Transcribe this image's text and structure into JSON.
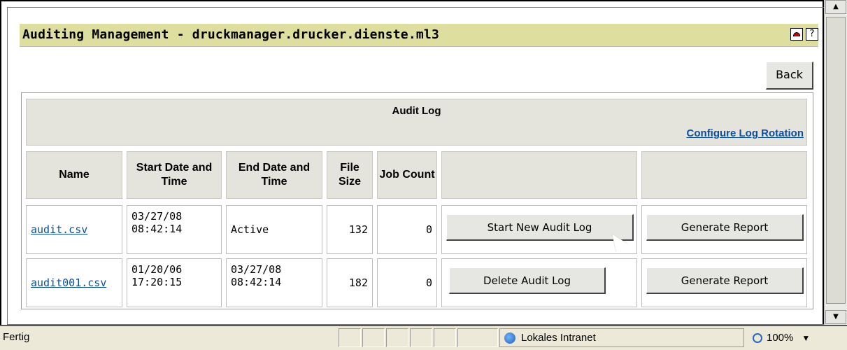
{
  "window": {
    "title": "Auditing Management - druckmanager.drucker.dienste.ml3",
    "back_label": "Back",
    "help_icon_text": "?"
  },
  "audit": {
    "title": "Audit Log",
    "rotation_link": "Configure Log Rotation",
    "columns": [
      "Name",
      "Start Date and Time",
      "End Date and Time",
      "File Size",
      "Job Count"
    ],
    "rows": [
      {
        "name": "audit.csv",
        "start_date": "03/27/08",
        "start_time": "08:42:14",
        "end_text": "Active",
        "size": "132",
        "job_count": "0",
        "action_label": "Start New Audit Log",
        "report_label": "Generate Report"
      },
      {
        "name": "audit001.csv",
        "start_date": "01/20/06",
        "start_time": "17:20:15",
        "end_date": "03/27/08",
        "end_time": "08:42:14",
        "size": "182",
        "job_count": "0",
        "action_label": "Delete Audit Log",
        "report_label": "Generate Report"
      }
    ]
  },
  "status": {
    "text": "Fertig",
    "zone": "Lokales Intranet",
    "zoom": "100%"
  },
  "icons": {
    "title_icon_1": "printer-icon",
    "title_icon_2": "help-icon",
    "zone_icon": "globe-icon",
    "zoom_icon": "magnifier-icon"
  },
  "colors": {
    "titlebar": "#dede9e",
    "link": "#0b4fa4",
    "header_cell": "#e4e4dc"
  }
}
